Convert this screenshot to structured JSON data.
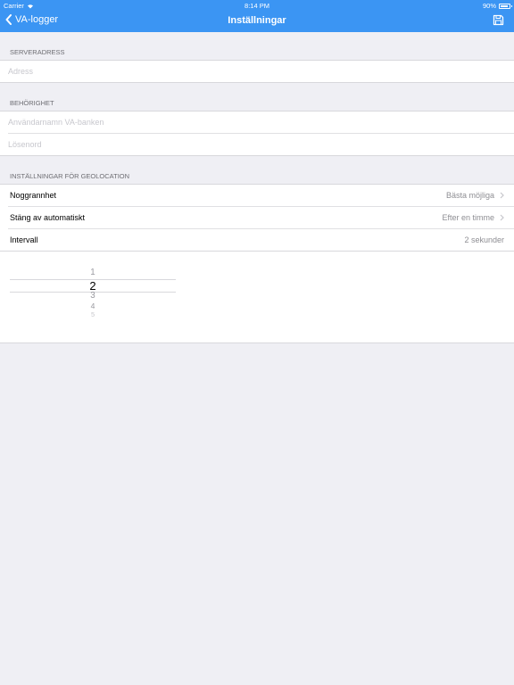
{
  "status_bar": {
    "carrier": "Carrier",
    "time": "8:14 PM",
    "battery": "90%",
    "battery_level": 0.9
  },
  "nav": {
    "back_label": "VA-logger",
    "title": "Inställningar",
    "save_icon": "save-icon"
  },
  "server": {
    "header": "SERVERADRESS",
    "address_placeholder": "Adress"
  },
  "auth": {
    "header": "BEHÖRIGHET",
    "username_placeholder": "Användarnamn VA-banken",
    "password_placeholder": "Lösenord"
  },
  "geo": {
    "header": "INSTÄLLNINGAR FÖR GEOLOCATION",
    "rows": [
      {
        "label": "Noggrannhet",
        "value": "Bästa möjliga"
      },
      {
        "label": "Stäng av automatiskt",
        "value": "Efter en timme"
      },
      {
        "label": "Intervall",
        "value": "2 sekunder"
      }
    ]
  },
  "picker": {
    "items": [
      "1",
      "2",
      "3",
      "4",
      "5"
    ],
    "selected": "2"
  }
}
